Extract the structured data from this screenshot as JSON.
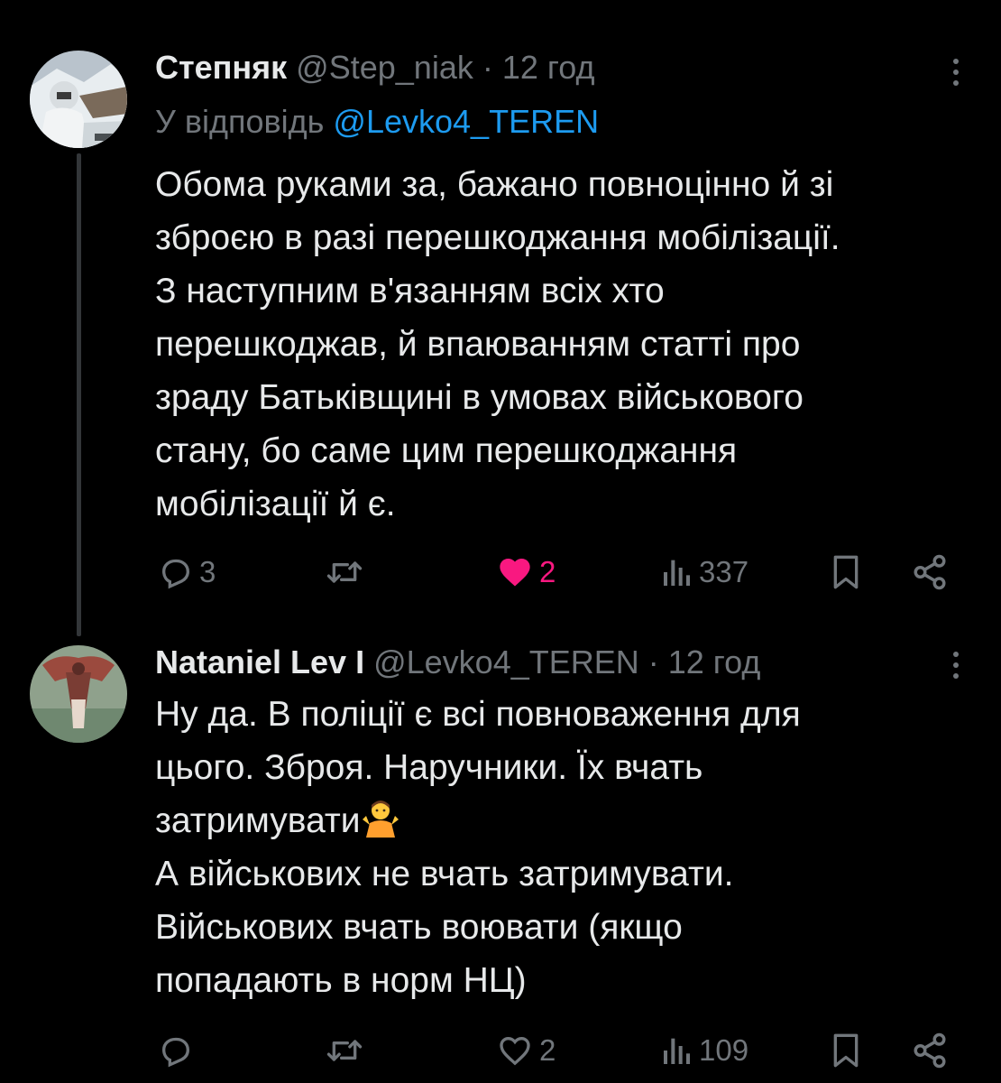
{
  "tweets": [
    {
      "display_name": "Степняк",
      "handle": "@Step_niak",
      "separator": "·",
      "time": "12 год",
      "reply_prefix": "У відповідь",
      "reply_to": "@Levko4_TEREN",
      "body_lines": [
        "Обома руками за, бажано повноцінно й зі",
        "зброєю в разі перешкоджання мобілізації.",
        "З наступним в'язанням всіх хто",
        "перешкоджав, й впаюванням статті про",
        "зраду Батьківщині в умовах військового",
        "стану, бо саме цим перешкоджання",
        "мобілізації й є."
      ],
      "replies": "3",
      "reposts": "",
      "likes": "2",
      "liked": true,
      "views": "337",
      "icons": {
        "avatar": "avatar-soldier-snow",
        "more": "more-icon",
        "reply": "reply-icon",
        "repost": "repost-icon",
        "like": "heart-filled-icon",
        "views": "views-icon",
        "bookmark": "bookmark-icon",
        "share": "share-icon"
      }
    },
    {
      "display_name": "Nataniel Lev I",
      "handle": "@Levko4_TEREN",
      "separator": "·",
      "time": "12 год",
      "body_lines": [
        "Ну да. В поліції є всі повноваження для",
        "цього. Зброя. Наручники. Їх вчать",
        "затримувати",
        "А військових не вчать затримувати.",
        "Військових вчать воювати (якщо",
        "попадають в норм НЦ)"
      ],
      "emoji": "🤷‍♀️",
      "replies": "",
      "reposts": "",
      "likes": "2",
      "liked": false,
      "views": "109",
      "icons": {
        "avatar": "avatar-bird",
        "more": "more-icon",
        "reply": "reply-icon",
        "repost": "repost-icon",
        "like": "heart-outline-icon",
        "views": "views-icon",
        "bookmark": "bookmark-icon",
        "share": "share-icon"
      }
    }
  ],
  "colors": {
    "background": "#000000",
    "text": "#e7e9ea",
    "muted": "#71767b",
    "link": "#1d9bf0",
    "like": "#f91880",
    "thread_line": "#333639"
  }
}
